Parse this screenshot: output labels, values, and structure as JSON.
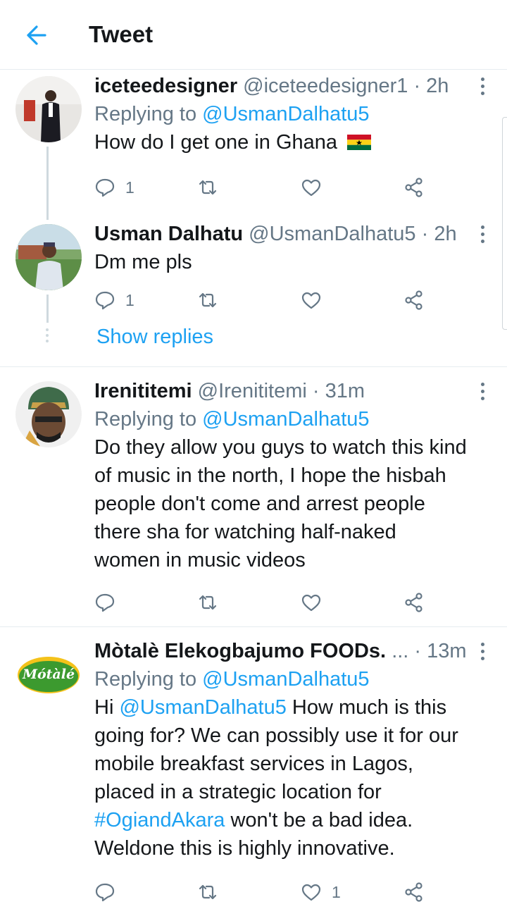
{
  "header": {
    "title": "Tweet"
  },
  "colors": {
    "accent": "#1da1f2",
    "muted": "#657786",
    "divider": "#e6ecf0"
  },
  "tweets": [
    {
      "name": "iceteedesigner",
      "handle": "@iceteedesigner1",
      "time": "2h",
      "replying_prefix": "Replying to",
      "replying_to": "@UsmanDalhatu5",
      "text": "How do I get one in Ghana",
      "emoji": "ghana-flag",
      "reply_count": "1",
      "like_count": ""
    },
    {
      "name": "Usman Dalhatu",
      "handle": "@UsmanDalhatu5",
      "time": "2h",
      "text": "Dm me pls",
      "reply_count": "1"
    },
    {
      "name": "Irenititemi",
      "handle": "@Irenititemi",
      "time": "31m",
      "replying_prefix": "Replying to",
      "replying_to": "@UsmanDalhatu5",
      "text_lines": [
        "Do they allow you guys to watch this kind",
        "of music in the north, I hope the hisbah",
        "people don't come and arrest people",
        "there sha for watching half-naked",
        "women in music videos"
      ]
    },
    {
      "name": "Mòtalè Elekogbajumo FOODs.",
      "ellipsis": "...",
      "time": "13m",
      "replying_prefix": "Replying to",
      "replying_to": "@UsmanDalhatu5",
      "line1_prefix": "Hi ",
      "line1_mention": "@UsmanDalhatu5",
      "line1_suffix": " How much is this",
      "line2": "going for? We can possibly use it for our",
      "line3": "mobile breakfast services in Lagos,",
      "line4": "placed in a strategic location for",
      "line5_hashtag": "#OgiandAkara",
      "line5_suffix": " won't be a bad idea.",
      "line6": "Weldone this is highly innovative.",
      "like_count": "1",
      "logo_text": "Mótàlé"
    }
  ],
  "show_replies": "Show replies"
}
